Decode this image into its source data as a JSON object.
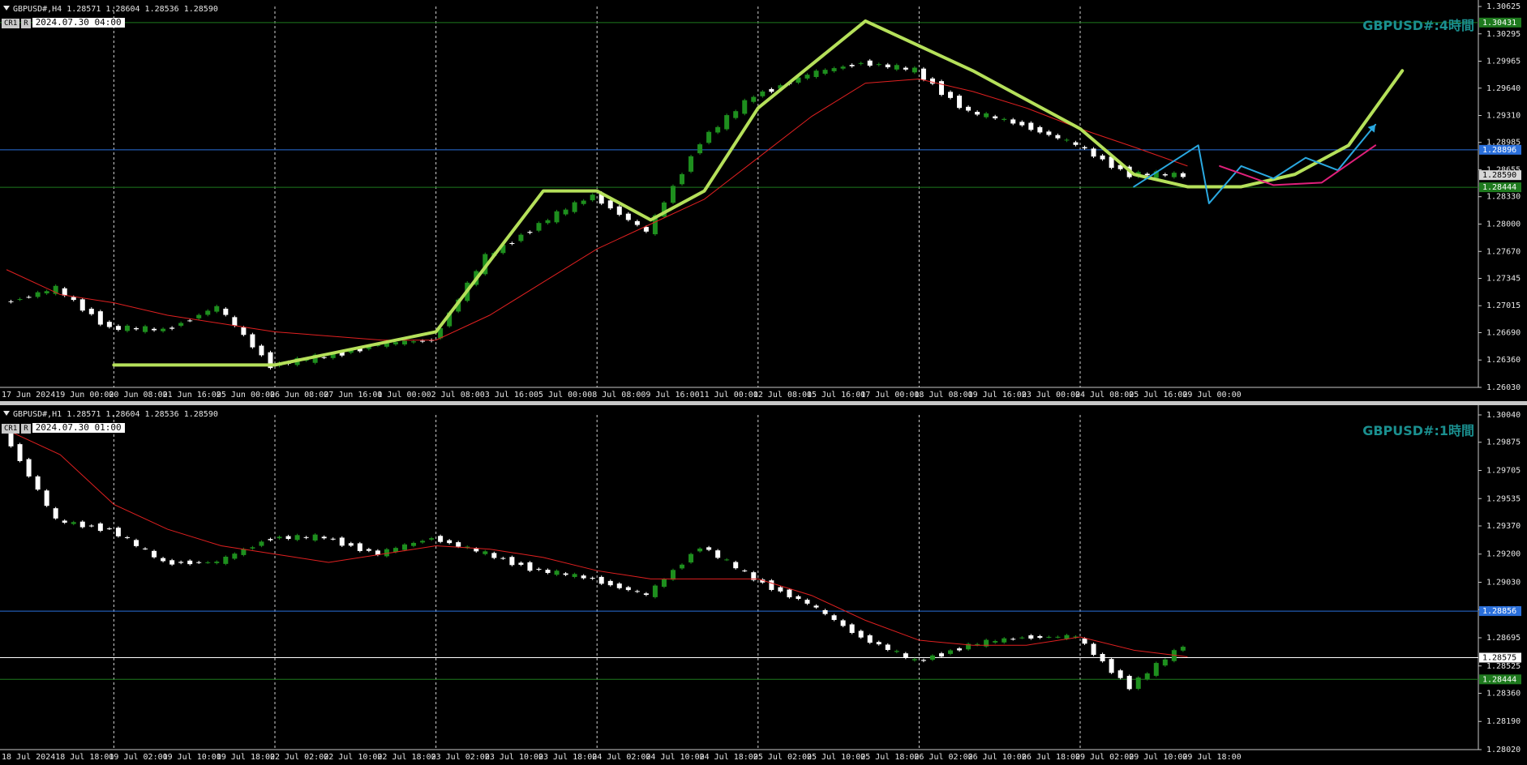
{
  "panels": [
    {
      "id": "h4",
      "header": "GBPUSD#,H4  1.28571 1.28604 1.28536 1.28590",
      "tag1": "CR1",
      "tag2": "R",
      "datetime": "2024.07.30 04:00",
      "title": "GBPUSD#:4時間",
      "price_ticks": [
        "1.30625",
        "1.30295",
        "1.29965",
        "1.29640",
        "1.29310",
        "1.28985",
        "1.28655",
        "1.28330",
        "1.28000",
        "1.27670",
        "1.27345",
        "1.27015",
        "1.26690",
        "1.26360",
        "1.26030"
      ],
      "time_ticks": [
        "17 Jun 2024",
        "19 Jun 00:00",
        "20 Jun 08:00",
        "21 Jun 16:00",
        "25 Jun 00:00",
        "26 Jun 08:00",
        "27 Jun 16:00",
        "1 Jul 00:00",
        "2 Jul 08:00",
        "3 Jul 16:00",
        "5 Jul 00:00",
        "8 Jul 08:00",
        "9 Jul 16:00",
        "11 Jul 00:00",
        "12 Jul 08:00",
        "15 Jul 16:00",
        "17 Jul 00:00",
        "18 Jul 08:00",
        "19 Jul 16:00",
        "23 Jul 00:00",
        "24 Jul 08:00",
        "25 Jul 16:00",
        "29 Jul 00:00"
      ],
      "level_labels": [
        {
          "text": "1.30431",
          "color": "#1e7a1e"
        },
        {
          "text": "1.28896",
          "color": "#2a6fdb"
        },
        {
          "text": "1.28590",
          "color": "#d8d8d8"
        },
        {
          "text": "1.28444",
          "color": "#1e7a1e"
        }
      ]
    },
    {
      "id": "h1",
      "header": "GBPUSD#,H1  1.28571 1.28604 1.28536 1.28590",
      "tag1": "CR1",
      "tag2": "R",
      "datetime": "2024.07.30 01:00",
      "title": "GBPUSD#:1時間",
      "price_ticks": [
        "1.30040",
        "1.29875",
        "1.29705",
        "1.29535",
        "1.29370",
        "1.29200",
        "1.29030",
        "1.28865",
        "1.28695",
        "1.28525",
        "1.28360",
        "1.28190",
        "1.28020"
      ],
      "time_ticks": [
        "18 Jul 2024",
        "18 Jul 18:00",
        "19 Jul 02:00",
        "19 Jul 10:00",
        "19 Jul 18:00",
        "22 Jul 02:00",
        "22 Jul 10:00",
        "22 Jul 18:00",
        "23 Jul 02:00",
        "23 Jul 10:00",
        "23 Jul 18:00",
        "24 Jul 02:00",
        "24 Jul 10:00",
        "24 Jul 18:00",
        "25 Jul 02:00",
        "25 Jul 10:00",
        "25 Jul 18:00",
        "26 Jul 02:00",
        "26 Jul 10:00",
        "26 Jul 18:00",
        "29 Jul 02:00",
        "29 Jul 10:00",
        "29 Jul 18:00"
      ],
      "level_labels": [
        {
          "text": "1.28856",
          "color": "#2a6fdb"
        },
        {
          "text": "1.28575",
          "color": "#ffffff"
        },
        {
          "text": "1.28444",
          "color": "#1e7a1e"
        }
      ]
    }
  ],
  "chart_data": [
    {
      "type": "line",
      "name": "GBPUSD#,H4",
      "ylim": [
        1.2603,
        1.30625
      ],
      "x": [
        "17 Jun 2024",
        "19 Jun 00:00",
        "20 Jun 08:00",
        "21 Jun 16:00",
        "25 Jun 00:00",
        "26 Jun 08:00",
        "27 Jun 16:00",
        "1 Jul 00:00",
        "2 Jul 08:00",
        "3 Jul 16:00",
        "5 Jul 00:00",
        "8 Jul 08:00",
        "9 Jul 16:00",
        "11 Jul 00:00",
        "12 Jul 08:00",
        "15 Jul 16:00",
        "17 Jul 00:00",
        "18 Jul 08:00",
        "19 Jul 16:00",
        "23 Jul 00:00",
        "24 Jul 08:00",
        "25 Jul 16:00",
        "29 Jul 00:00"
      ],
      "series": [
        {
          "values": [
            1.2705,
            1.2722,
            1.2675,
            1.2672,
            1.27,
            1.263,
            1.264,
            1.2655,
            1.266,
            1.276,
            1.28,
            1.2835,
            1.279,
            1.29,
            1.2955,
            1.298,
            1.2995,
            1.2985,
            1.2935,
            1.292,
            1.2895,
            1.286,
            1.2859
          ],
          "color": "#ffffff"
        },
        {
          "values": [
            1.2745,
            1.2715,
            1.2705,
            1.269,
            1.268,
            1.267,
            1.2665,
            1.266,
            1.266,
            1.269,
            1.273,
            1.277,
            1.28,
            1.283,
            1.288,
            1.293,
            1.297,
            1.2975,
            1.296,
            1.294,
            1.2915,
            1.2893,
            1.287
          ],
          "color": "#e02020"
        }
      ],
      "horizontal_lines": [
        {
          "price": 1.30431,
          "color": "#1e7a1e"
        },
        {
          "price": 1.28896,
          "color": "#2a6fdb"
        },
        {
          "price": 1.28444,
          "color": "#1e7a1e"
        }
      ],
      "drawings": [
        {
          "color": "#b5e05a",
          "points": [
            [
              2,
              1.263
            ],
            [
              5,
              1.263
            ],
            [
              8,
              1.267
            ],
            [
              10,
              1.284
            ],
            [
              11,
              1.284
            ],
            [
              12,
              1.2805
            ],
            [
              13,
              1.284
            ],
            [
              14,
              1.294
            ],
            [
              16,
              1.3045
            ],
            [
              18,
              1.2985
            ],
            [
              20,
              1.2915
            ],
            [
              21,
              1.286
            ],
            [
              22,
              1.2845
            ],
            [
              23,
              1.2845
            ],
            [
              24,
              1.286
            ],
            [
              25,
              1.2895
            ],
            [
              26,
              1.2985
            ]
          ]
        },
        {
          "color": "#2aa8e0",
          "points": [
            [
              21,
              1.2845
            ],
            [
              22.2,
              1.2895
            ],
            [
              22.4,
              1.2825
            ],
            [
              23,
              1.287
            ],
            [
              23.6,
              1.2855
            ],
            [
              24.2,
              1.288
            ],
            [
              24.8,
              1.2865
            ],
            [
              25.5,
              1.292
            ]
          ]
        },
        {
          "color": "#e0207a",
          "points": [
            [
              22.6,
              1.287
            ],
            [
              23.6,
              1.2847
            ],
            [
              24.5,
              1.285
            ],
            [
              25.5,
              1.2895
            ]
          ]
        }
      ]
    },
    {
      "type": "line",
      "name": "GBPUSD#,H1",
      "ylim": [
        1.2802,
        1.3004
      ],
      "x": [
        "18 Jul 2024",
        "18 Jul 18:00",
        "19 Jul 02:00",
        "19 Jul 10:00",
        "19 Jul 18:00",
        "22 Jul 02:00",
        "22 Jul 10:00",
        "22 Jul 18:00",
        "23 Jul 02:00",
        "23 Jul 10:00",
        "23 Jul 18:00",
        "24 Jul 02:00",
        "24 Jul 10:00",
        "24 Jul 18:00",
        "25 Jul 02:00",
        "25 Jul 10:00",
        "25 Jul 18:00",
        "26 Jul 02:00",
        "26 Jul 10:00",
        "26 Jul 18:00",
        "29 Jul 02:00",
        "29 Jul 10:00",
        "29 Jul 18:00"
      ],
      "series": [
        {
          "values": [
            1.2995,
            1.294,
            1.2935,
            1.2915,
            1.2915,
            1.293,
            1.293,
            1.292,
            1.293,
            1.292,
            1.291,
            1.2905,
            1.2895,
            1.2925,
            1.2905,
            1.289,
            1.287,
            1.2855,
            1.2865,
            1.287,
            1.287,
            1.284,
            1.2865
          ],
          "color": "#ffffff"
        },
        {
          "values": [
            1.2995,
            1.298,
            1.295,
            1.2935,
            1.2925,
            1.292,
            1.2915,
            1.292,
            1.2925,
            1.2923,
            1.2918,
            1.291,
            1.2905,
            1.2905,
            1.2905,
            1.2895,
            1.288,
            1.2868,
            1.2865,
            1.2865,
            1.287,
            1.2862,
            1.2858
          ],
          "color": "#e02020"
        }
      ],
      "horizontal_lines": [
        {
          "price": 1.28856,
          "color": "#2a6fdb"
        },
        {
          "price": 1.28575,
          "color": "#ffffff"
        },
        {
          "price": 1.28444,
          "color": "#1e7a1e"
        }
      ],
      "drawings": []
    }
  ]
}
